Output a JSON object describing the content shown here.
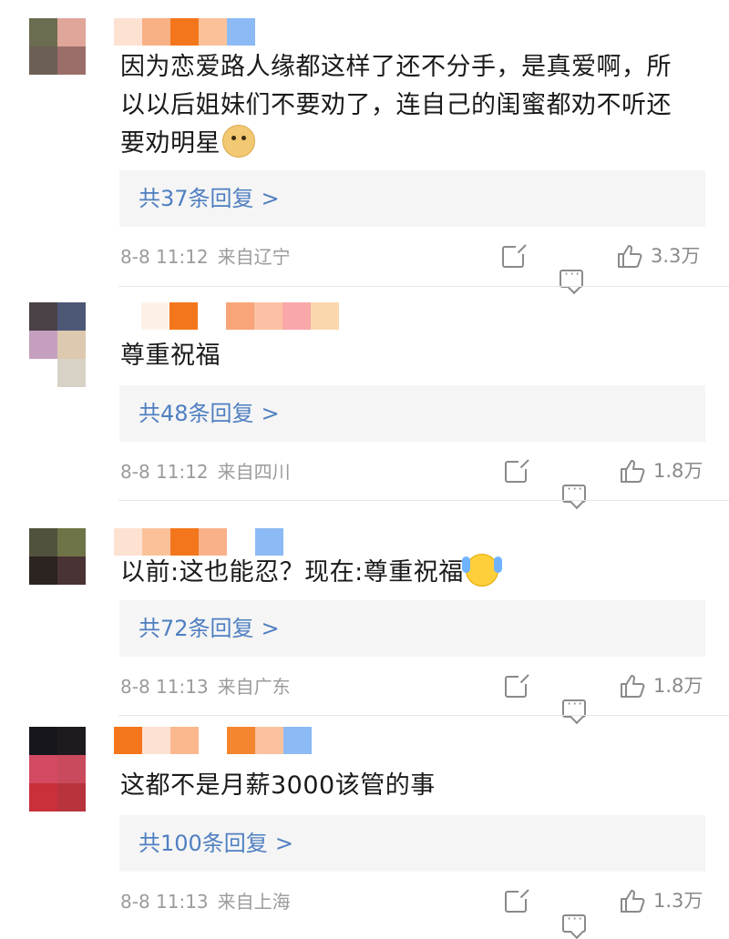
{
  "colors": {
    "link": "#4f7fc1",
    "reply_bg": "#f5f5f5",
    "meta": "#9b9b9b"
  },
  "comments": [
    {
      "text_lines": [
        "因为恋爱路人缘都这样了还不分手，是真爱啊，所",
        "以以后姐妹们不要劝了，连自己的闺蜜都劝不听还",
        "要劝明星"
      ],
      "emoji": "doge-emoji",
      "replies_label": "共37条回复",
      "reply_arrow": ">",
      "time": "8-8 11:12",
      "location": "来自辽宁",
      "likes": "3.3万",
      "avatar_colors": [
        "#6b6c50",
        "#e0a69a",
        "#6b5f56",
        "#9c6e69"
      ],
      "name_blur_colors": [
        "#fde2d2",
        "#f8b184",
        "#f4761c",
        "#fbc29a",
        "#8bbaf5"
      ]
    },
    {
      "text_lines": [
        "尊重祝福"
      ],
      "emoji": "",
      "replies_label": "共48条回复",
      "reply_arrow": ">",
      "time": "8-8 11:12",
      "location": "来自四川",
      "likes": "1.8万",
      "avatar_colors": [
        "#4a4247",
        "#4d5877",
        "#c59fbe",
        "#dcc9b0",
        "#ffffff",
        "#d8d2c6"
      ],
      "name_blur_colors": [
        "#fdf1e7",
        "#f4761c",
        "#ffffff",
        "#f7a579",
        "#fbc1a4",
        "#f9a7a9",
        "#fbd7ad"
      ]
    },
    {
      "text_lines": [
        "以前:这也能忍？现在:尊重祝福"
      ],
      "emoji": "cry-emoji",
      "replies_label": "共72条回复",
      "reply_arrow": ">",
      "time": "8-8 11:13",
      "location": "来自广东",
      "likes": "1.8万",
      "avatar_colors": [
        "#50523e",
        "#6f7448",
        "#2b2421",
        "#4a3335"
      ],
      "name_blur_colors": [
        "#fde2d2",
        "#fbc29a",
        "#f4761c",
        "#f9b18a",
        "#ffffff",
        "#8bbaf5"
      ]
    },
    {
      "text_lines": [
        "这都不是月薪3000该管的事"
      ],
      "emoji": "",
      "replies_label": "共100条回复",
      "reply_arrow": ">",
      "time": "8-8 11:13",
      "location": "来自上海",
      "likes": "1.3万",
      "avatar_colors": [
        "#17161d",
        "#1f1a1e",
        "#d34a62",
        "#c94a5c",
        "#c9303a",
        "#b9333c"
      ],
      "name_blur_colors": [
        "#f4761c",
        "#fde2d2",
        "#fbb88e",
        "#ffffff",
        "#f4862f",
        "#fbc2a0",
        "#8bbaf5"
      ]
    }
  ]
}
